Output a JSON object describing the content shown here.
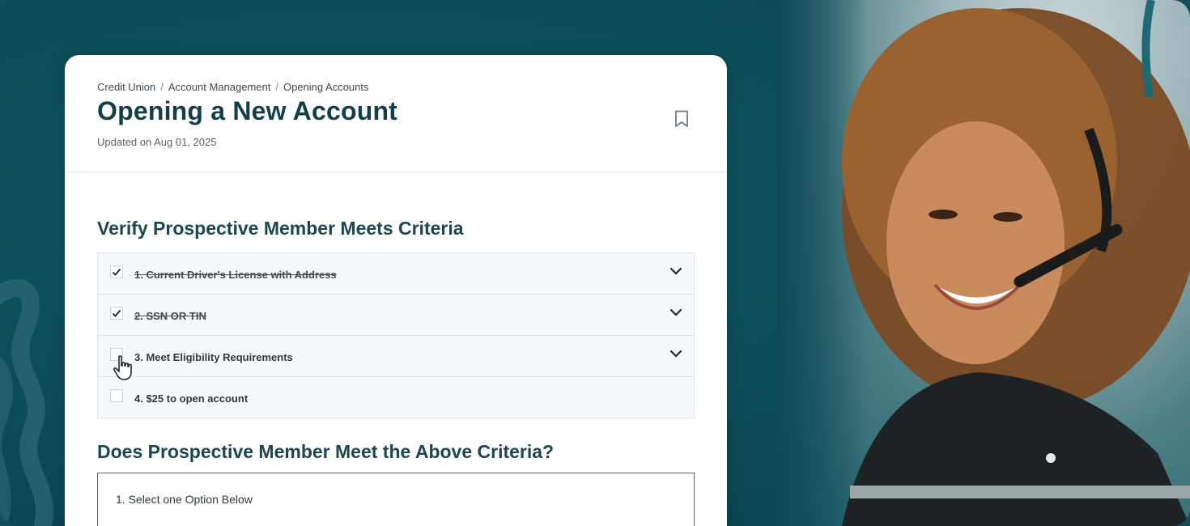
{
  "breadcrumb": {
    "items": [
      "Credit Union",
      "Account Management",
      "Opening Accounts"
    ],
    "separator": "/"
  },
  "page": {
    "title": "Opening a New Account",
    "updated": "Updated on Aug 01, 2025"
  },
  "section1": {
    "title": "Verify Prospective Member Meets Criteria",
    "items": [
      {
        "label": "1. Current Driver's License with Address ",
        "checked": true
      },
      {
        "label": "2. SSN OR TIN",
        "checked": true
      },
      {
        "label": "3. Meet Eligibility Requirements",
        "checked": false
      },
      {
        "label": "4. $25 to open account",
        "checked": false
      }
    ]
  },
  "section2": {
    "title": "Does Prospective Member Meet the Above Criteria?",
    "question": "1. Select one Option Below"
  },
  "colors": {
    "background": "#0e4f5b",
    "title": "#123f4a",
    "card": "#ffffff"
  },
  "icons": {
    "bookmark": "bookmark-icon",
    "chevron": "chevron-down-icon",
    "check": "checkmark-icon",
    "cursor": "hand-pointer-icon"
  }
}
